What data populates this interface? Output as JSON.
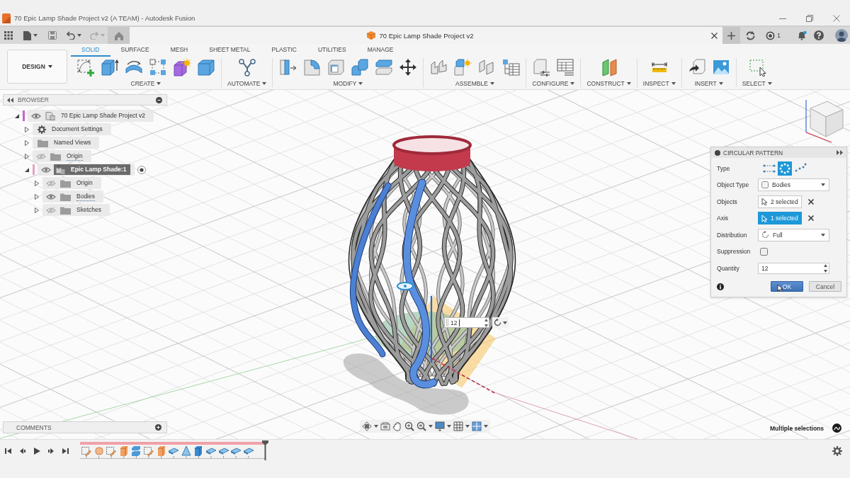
{
  "window": {
    "title": "70 Epic Lamp Shade Project v2 (A TEAM) - Autodesk Fusion"
  },
  "document_tab": {
    "title": "70 Epic Lamp Shade Project v2"
  },
  "header": {
    "job_count": "1"
  },
  "workspace": {
    "label": "DESIGN"
  },
  "toolbar": {
    "tabs": [
      {
        "label": "SOLID",
        "selected": true
      },
      {
        "label": "SURFACE",
        "selected": false
      },
      {
        "label": "MESH",
        "selected": false
      },
      {
        "label": "SHEET METAL",
        "selected": false
      },
      {
        "label": "PLASTIC",
        "selected": false
      },
      {
        "label": "UTILITIES",
        "selected": false
      },
      {
        "label": "MANAGE",
        "selected": false
      }
    ],
    "groups": [
      {
        "label": "CREATE"
      },
      {
        "label": "AUTOMATE"
      },
      {
        "label": "MODIFY"
      },
      {
        "label": "ASSEMBLE"
      },
      {
        "label": "CONFIGURE"
      },
      {
        "label": "CONSTRUCT"
      },
      {
        "label": "INSPECT"
      },
      {
        "label": "INSERT"
      },
      {
        "label": "SELECT"
      }
    ]
  },
  "browser": {
    "title": "BROWSER",
    "tree": [
      {
        "label": "70 Epic Lamp Shade Project v2",
        "kind": "document",
        "expanded": true,
        "visible": true,
        "selected": false,
        "mixed_visibility": false,
        "color": "#c466c8",
        "children": [
          {
            "label": "Document Settings",
            "kind": "settings",
            "expanded": false,
            "selected": false,
            "mixed_visibility": false
          },
          {
            "label": "Named Views",
            "kind": "folder",
            "expanded": false,
            "selected": false,
            "mixed_visibility": false
          },
          {
            "label": "Origin",
            "kind": "folder",
            "expanded": false,
            "visible": false,
            "selected": false,
            "mixed_visibility": true
          },
          {
            "label": "Epic Lamp Shade:1",
            "kind": "component",
            "expanded": true,
            "visible": true,
            "selected": true,
            "mixed_visibility": false,
            "color": "#e6a3c4",
            "children": [
              {
                "label": "Origin",
                "kind": "folder",
                "expanded": false,
                "visible": false,
                "selected": false,
                "mixed_visibility": false
              },
              {
                "label": "Bodies",
                "kind": "folder",
                "expanded": false,
                "visible": true,
                "selected": false,
                "mixed_visibility": true
              },
              {
                "label": "Sketches",
                "kind": "folder",
                "expanded": false,
                "visible": false,
                "selected": false,
                "mixed_visibility": false
              }
            ]
          }
        ]
      }
    ]
  },
  "viewport": {
    "quantity_input": {
      "value": "12"
    },
    "status": "Multiple selections"
  },
  "dialog": {
    "title": "CIRCULAR PATTERN",
    "rows": [
      {
        "label": "Type",
        "kind": "type",
        "options": [
          {
            "selected": false
          },
          {
            "selected": true
          },
          {
            "selected": false
          }
        ]
      },
      {
        "label": "Object Type",
        "kind": "dropdown",
        "value": "Bodies"
      },
      {
        "label": "Objects",
        "kind": "selection",
        "value": "2 selected",
        "selected": false
      },
      {
        "label": "Axis",
        "kind": "selection",
        "value": "1 selected",
        "selected": true
      },
      {
        "label": "Distribution",
        "kind": "dropdown",
        "value": "Full"
      },
      {
        "label": "Suppression",
        "kind": "checkbox",
        "checked": false
      },
      {
        "label": "Quantity",
        "kind": "spinner",
        "value": "12"
      }
    ],
    "buttons": [
      {
        "label": "OK",
        "primary": true
      },
      {
        "label": "Cancel",
        "primary": false
      }
    ]
  },
  "comments": {
    "title": "COMMENTS"
  }
}
